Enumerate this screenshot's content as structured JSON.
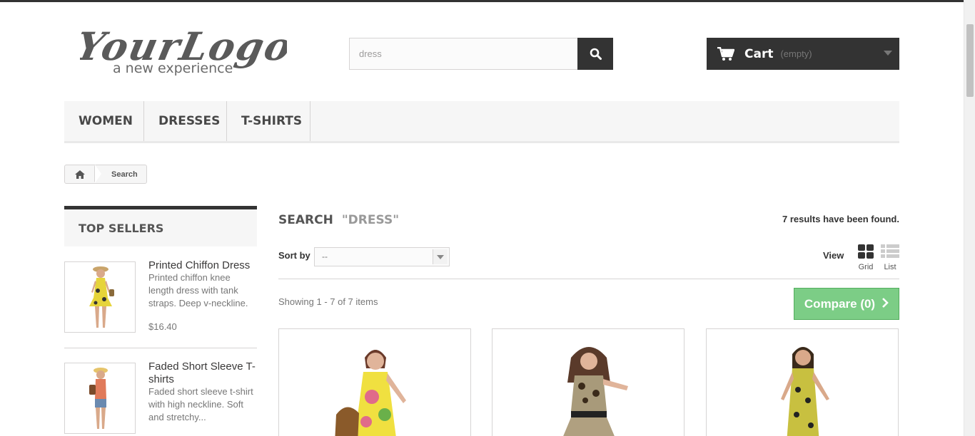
{
  "header": {
    "logo": {
      "main": "YourLogo",
      "tagline": "a new experience"
    },
    "search": {
      "value": "dress",
      "icon": "search-icon"
    },
    "cart": {
      "title": "Cart",
      "status": "(empty)",
      "icon": "cart-icon"
    }
  },
  "menu": {
    "items": [
      {
        "label": "WOMEN"
      },
      {
        "label": "DRESSES"
      },
      {
        "label": "T-SHIRTS"
      }
    ]
  },
  "breadcrumb": {
    "home_icon": "home-icon",
    "current": "Search"
  },
  "sidebar": {
    "title": "TOP SELLERS",
    "items": [
      {
        "name": "Printed Chiffon Dress",
        "description": "Printed chiffon knee length dress with tank straps. Deep v-neckline.",
        "price": "$16.40"
      },
      {
        "name": "Faded Short Sleeve T-shirts",
        "description": "Faded short sleeve t-shirt with high neckline. Soft and stretchy..."
      }
    ]
  },
  "main": {
    "title": "SEARCH",
    "term": "\"DRESS\"",
    "results_count": "7 results have been found.",
    "sort": {
      "label": "Sort by",
      "selected": "--"
    },
    "view": {
      "label": "View",
      "grid_label": "Grid",
      "list_label": "List"
    },
    "showing": "Showing 1 - 7 of 7 items",
    "compare": {
      "label": "Compare (0)"
    }
  },
  "colors": {
    "dark": "#333333",
    "compare_green": "#7ccd86",
    "menu_bg": "#f6f6f6",
    "border": "#d6d4d4"
  }
}
